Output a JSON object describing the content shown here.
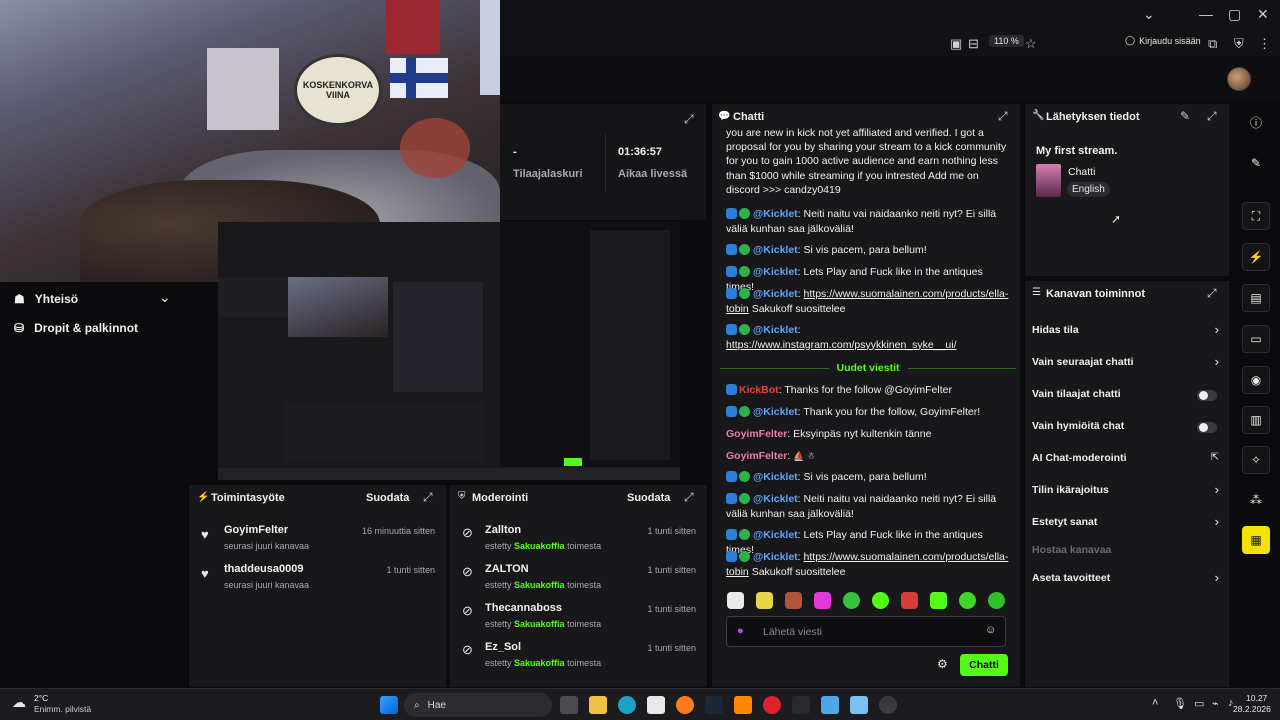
{
  "browser": {
    "zoom": "110 %",
    "login": "Kirjaudu sisään"
  },
  "video": {
    "sticker_line1": "KOSKENKORVA",
    "sticker_line2": "VIINA"
  },
  "leftnav": {
    "items": [
      {
        "label": "Yhteisö",
        "icon": "community-icon"
      },
      {
        "label": "Dropit & palkinnot",
        "icon": "drops-icon"
      }
    ]
  },
  "stats": {
    "subs_value": "-",
    "subs_label": "Tilaajalaskuri",
    "uptime_value": "01:36:57",
    "uptime_label": "Aikaa livessä"
  },
  "activity": {
    "title": "Toimintasyöte",
    "filter": "Suodata",
    "items": [
      {
        "name": "GoyimFelter",
        "sub": "seurasi juuri kanavaa",
        "time": "16 minuuttia sitten"
      },
      {
        "name": "thaddeusa0009",
        "sub": "seurasi juuri kanavaa",
        "time": "1 tunti sitten"
      }
    ]
  },
  "moderation": {
    "title": "Moderointi",
    "filter": "Suodata",
    "items": [
      {
        "name": "Zallton",
        "pre": "estetty",
        "by": "Sakuakoffia",
        "post": "toimesta",
        "time": "1 tunti sitten"
      },
      {
        "name": "ZALTON",
        "pre": "estetty",
        "by": "Sakuakoffia",
        "post": "toimesta",
        "time": "1 tunti sitten"
      },
      {
        "name": "Thecannaboss",
        "pre": "estetty",
        "by": "Sakuakoffia",
        "post": "toimesta",
        "time": "1 tunti sitten"
      },
      {
        "name": "Ez_Sol",
        "pre": "estetty",
        "by": "Sakuakoffia",
        "post": "toimesta",
        "time": "1 tunti sitten"
      }
    ]
  },
  "chat": {
    "title": "Chatti",
    "top_text": "you are new in kick not yet affiliated and verified. I got a proposal for you by sharing your stream to a kick community for you to gain 1000 active audience and earn nothing less than $1000 while streaming if you intrested Add me on discord >>> candzy0419",
    "m1_user": "@Kicklet",
    "m1_text": ": Neiti naitu vai naidaanko neiti nyt? Ei sillä väliä kunhan saa jälkoväliä!",
    "m2_user": "@Kicklet",
    "m2_text": ": Si vis pacem, para bellum!",
    "m3_user": "@Kicklet",
    "m3_text": ": Lets Play and Fuck like in the antiques times!",
    "m4_user": "@Kicklet",
    "m4_link": "https://www.suomalainen.com/products/ella-tobin",
    "m4_text": " Sakukoff suosittelee",
    "m5_user": "@Kicklet",
    "m5_link": "https://www.instagram.com/psyykkinen_syke__ui/",
    "new_messages": "Uudet viestit",
    "n1_user": "KickBot",
    "n1_text": ": Thanks for the follow @GoyimFelter",
    "n2_user": "@Kicklet",
    "n2_text": ": Thank you for the follow, GoyimFelter!",
    "n3_user": "GoyimFelter",
    "n3_text": ": Eksyinpäs nyt kultenkin tänne",
    "n4_user": "GoyimFelter",
    "n4_text": ":",
    "n5_user": "@Kicklet",
    "n5_text": ": Si vis pacem, para bellum!",
    "n6_user": "@Kicklet",
    "n6_text": ": Neiti naitu vai naidaanko neiti nyt? Ei sillä väliä kunhan saa jälkoväliä!",
    "n7_user": "@Kicklet",
    "n7_text": ": Lets Play and Fuck like in the antiques times!",
    "n8_user": "@Kicklet",
    "n8_link": "https://www.suomalainen.com/products/ella-tobin",
    "n8_text": " Sakukoff suosittelee",
    "input_placeholder": "Lähetä viesti",
    "send_label": "Chatti"
  },
  "stream_info": {
    "title": "Lähetyksen tiedot",
    "stream_title": "My first stream.",
    "category": "Chatti",
    "language": "English"
  },
  "channel": {
    "title": "Kanavan toiminnot",
    "items": [
      {
        "label": "Hidas tila",
        "control": "chevron"
      },
      {
        "label": "Vain seuraajat chatti",
        "control": "chevron"
      },
      {
        "label": "Vain tilaajat chatti",
        "control": "toggle"
      },
      {
        "label": "Vain hymiöitä chat",
        "control": "toggle"
      },
      {
        "label": "AI Chat-moderointi",
        "control": "external"
      },
      {
        "label": "Tilin ikärajoitus",
        "control": "chevron"
      },
      {
        "label": "Estetyt sanat",
        "control": "chevron"
      },
      {
        "label": "Hostaa kanavaa",
        "control": "none"
      },
      {
        "label": "Aseta tavoitteet",
        "control": "chevron"
      }
    ]
  },
  "taskbar": {
    "weather_temp": "2°C",
    "weather_desc": "Enimm. pilvistä",
    "search": "Hae",
    "time": "10.27",
    "date": "28.2.2026"
  },
  "colors": {
    "accent": "#53fc18",
    "panel": "#18181b",
    "background": "#0b0b0d"
  }
}
